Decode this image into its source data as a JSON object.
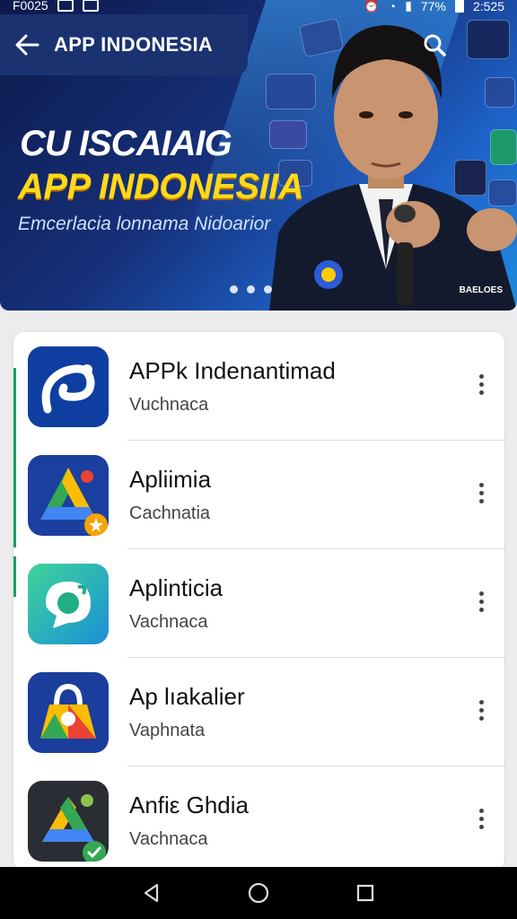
{
  "status_bar": {
    "carrier": "F0025",
    "battery_percent": "77%",
    "time": "2:525"
  },
  "app_bar": {
    "title": "APP INDONESIA"
  },
  "hero": {
    "title_line1": "CU ISCAIAIG",
    "title_line2": "APP INDONESIIA",
    "subtitle": "Emcerlacia lonnama Nidoarior",
    "tag": "BAELOES",
    "slide_count": 3
  },
  "apps": [
    {
      "name": "APPk Indenantimad",
      "subtitle": "Vuchnaca",
      "icon": "swirl-app-icon"
    },
    {
      "name": "Apliimia",
      "subtitle": "Cachnatia",
      "icon": "triangle-app-icon"
    },
    {
      "name": "Aplinticia",
      "subtitle": "Vachnaca",
      "icon": "chat-app-icon"
    },
    {
      "name": "Ap lıakalier",
      "subtitle": "Vaphnata",
      "icon": "bag-app-icon"
    },
    {
      "name": "Anfiε Ghdia",
      "subtitle": "Vachnaca",
      "icon": "drive-app-icon"
    }
  ],
  "colors": {
    "app_bar": "#1a3270",
    "hero_yellow": "#ffd91a",
    "accent_green": "#16a061"
  }
}
